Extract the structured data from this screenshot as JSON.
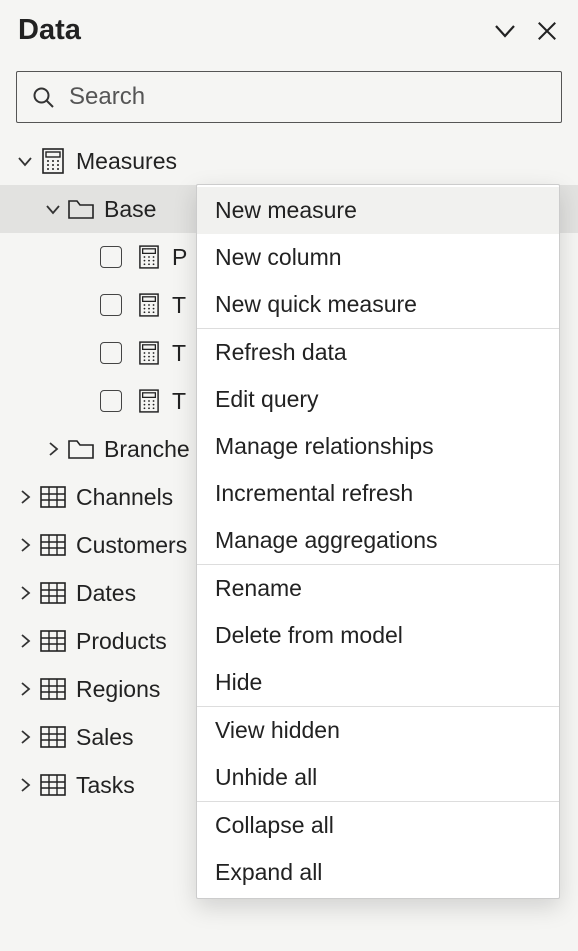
{
  "header": {
    "title": "Data"
  },
  "search": {
    "placeholder": "Search"
  },
  "tree": {
    "measures_label": "Measures",
    "base_label": "Base",
    "base_items": [
      "P",
      "T",
      "T",
      "T"
    ],
    "branches_label": "Branche",
    "tables": [
      "Channels",
      "Customers",
      "Dates",
      "Products",
      "Regions",
      "Sales",
      "Tasks"
    ]
  },
  "menu": {
    "items": [
      "New measure",
      "New column",
      "New quick measure",
      "Refresh data",
      "Edit query",
      "Manage relationships",
      "Incremental refresh",
      "Manage aggregations",
      "Rename",
      "Delete from model",
      "Hide",
      "View hidden",
      "Unhide all",
      "Collapse all",
      "Expand all"
    ]
  }
}
